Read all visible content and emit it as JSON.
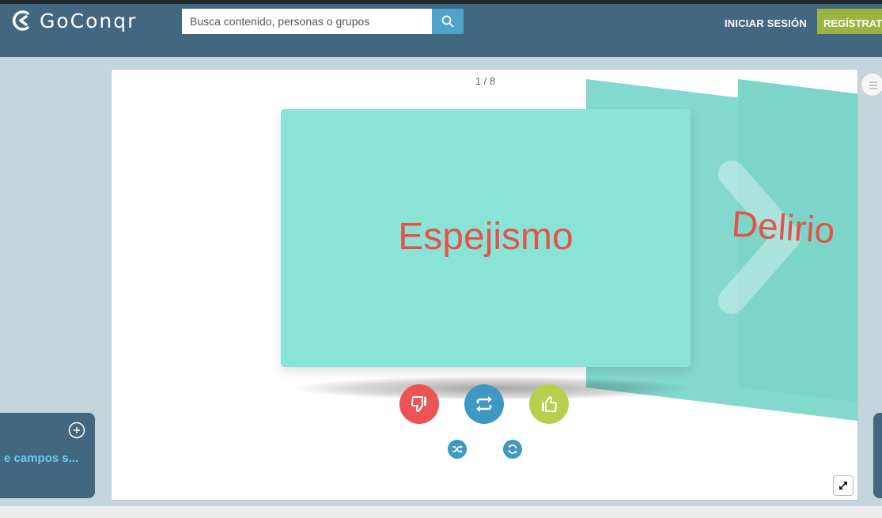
{
  "header": {
    "logo_text": "GoConqr",
    "search_placeholder": "Busca contenido, personas o grupos",
    "login_label": "INICIAR SESIÓN",
    "register_label": "REGÍSTRATE"
  },
  "viewer": {
    "counter": "1 / 8",
    "current_card_term": "Espejismo",
    "next_card_term": "Delirio"
  },
  "left_panel": {
    "label": "e campos s..."
  },
  "colors": {
    "header_bg": "#416781",
    "card_front": "#8ae3d7",
    "card_text": "#e45348",
    "dislike": "#ec5353",
    "flip": "#3e98c3",
    "like": "#b7d04c",
    "register": "#9bb340"
  },
  "icons": {
    "search": "search-icon",
    "dislike": "thumbs-down-icon",
    "flip": "flip-icon",
    "like": "thumbs-up-icon",
    "shuffle": "shuffle-icon",
    "restart": "restart-icon",
    "fullscreen": "expand-icon",
    "plus": "plus-circle-icon",
    "menu": "list-icon"
  }
}
